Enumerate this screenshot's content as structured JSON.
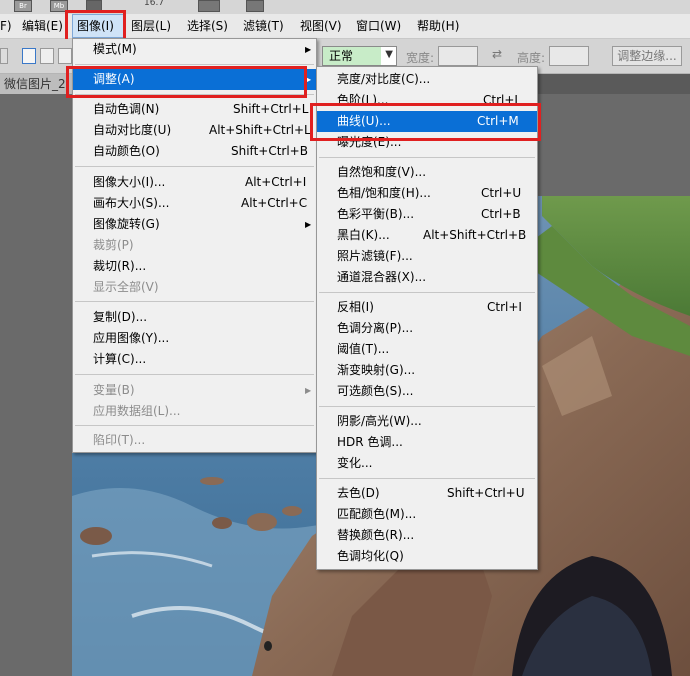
{
  "top_strip": {
    "icons": [
      "Br",
      "Mb"
    ],
    "zoom_text": "16.7"
  },
  "menubar": {
    "items": [
      {
        "label": "F)"
      },
      {
        "label": "编辑(E)"
      },
      {
        "label": "图像(I)"
      },
      {
        "label": "图层(L)"
      },
      {
        "label": "选择(S)"
      },
      {
        "label": "滤镜(T)"
      },
      {
        "label": "视图(V)"
      },
      {
        "label": "窗口(W)"
      },
      {
        "label": "帮助(H)"
      }
    ]
  },
  "options_bar": {
    "mode_value": "正常",
    "width_label": "宽度:",
    "height_label": "高度:",
    "refine_edge_button": "调整边缘..."
  },
  "document_tab": {
    "title": "微信图片_2"
  },
  "image_menu": {
    "items": [
      {
        "label": "模式(M)",
        "shortcut": "",
        "submenu": true,
        "disabled": false
      },
      {
        "label": "调整(A)",
        "shortcut": "",
        "submenu": true,
        "disabled": false,
        "highlighted": true
      },
      {
        "label": "自动色调(N)",
        "shortcut": "Shift+Ctrl+L",
        "disabled": false
      },
      {
        "label": "自动对比度(U)",
        "shortcut": "Alt+Shift+Ctrl+L",
        "disabled": false
      },
      {
        "label": "自动颜色(O)",
        "shortcut": "Shift+Ctrl+B",
        "disabled": false
      },
      {
        "label": "图像大小(I)...",
        "shortcut": "Alt+Ctrl+I",
        "disabled": false
      },
      {
        "label": "画布大小(S)...",
        "shortcut": "Alt+Ctrl+C",
        "disabled": false
      },
      {
        "label": "图像旋转(G)",
        "shortcut": "",
        "submenu": true,
        "disabled": false
      },
      {
        "label": "裁剪(P)",
        "shortcut": "",
        "disabled": true
      },
      {
        "label": "裁切(R)...",
        "shortcut": "",
        "disabled": false
      },
      {
        "label": "显示全部(V)",
        "shortcut": "",
        "disabled": true
      },
      {
        "label": "复制(D)...",
        "shortcut": "",
        "disabled": false
      },
      {
        "label": "应用图像(Y)...",
        "shortcut": "",
        "disabled": false
      },
      {
        "label": "计算(C)...",
        "shortcut": "",
        "disabled": false
      },
      {
        "label": "变量(B)",
        "shortcut": "",
        "submenu": true,
        "disabled": true
      },
      {
        "label": "应用数据组(L)...",
        "shortcut": "",
        "disabled": true
      },
      {
        "label": "陷印(T)...",
        "shortcut": "",
        "disabled": true
      }
    ]
  },
  "adjust_menu": {
    "items": [
      {
        "label": "亮度/对比度(C)...",
        "shortcut": ""
      },
      {
        "label": "色阶(L)...",
        "shortcut": "Ctrl+L"
      },
      {
        "label": "曲线(U)...",
        "shortcut": "Ctrl+M",
        "highlighted": true
      },
      {
        "label": "曝光度(E)...",
        "shortcut": ""
      },
      {
        "label": "自然饱和度(V)...",
        "shortcut": ""
      },
      {
        "label": "色相/饱和度(H)...",
        "shortcut": "Ctrl+U"
      },
      {
        "label": "色彩平衡(B)...",
        "shortcut": "Ctrl+B"
      },
      {
        "label": "黑白(K)...",
        "shortcut": "Alt+Shift+Ctrl+B"
      },
      {
        "label": "照片滤镜(F)...",
        "shortcut": ""
      },
      {
        "label": "通道混合器(X)...",
        "shortcut": ""
      },
      {
        "label": "反相(I)",
        "shortcut": "Ctrl+I"
      },
      {
        "label": "色调分离(P)...",
        "shortcut": ""
      },
      {
        "label": "阈值(T)...",
        "shortcut": ""
      },
      {
        "label": "渐变映射(G)...",
        "shortcut": ""
      },
      {
        "label": "可选颜色(S)...",
        "shortcut": ""
      },
      {
        "label": "阴影/高光(W)...",
        "shortcut": ""
      },
      {
        "label": "HDR 色调...",
        "shortcut": ""
      },
      {
        "label": "变化...",
        "shortcut": ""
      },
      {
        "label": "去色(D)",
        "shortcut": "Shift+Ctrl+U"
      },
      {
        "label": "匹配颜色(M)...",
        "shortcut": ""
      },
      {
        "label": "替换颜色(R)...",
        "shortcut": ""
      },
      {
        "label": "色调均化(Q)",
        "shortcut": ""
      }
    ]
  },
  "colors": {
    "highlight": "#0a6fd6",
    "annotation_red": "#e02020",
    "mode_bg": "#c8ecc8"
  }
}
